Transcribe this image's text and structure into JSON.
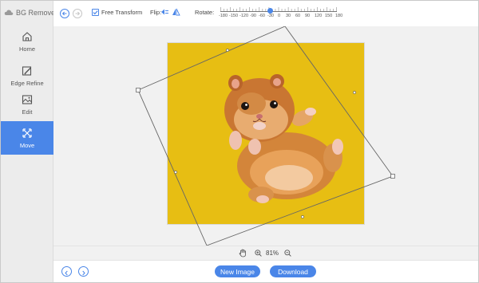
{
  "app": {
    "title": "BG Remover"
  },
  "sidebar": {
    "items": [
      {
        "label": "Home",
        "icon": "home-icon",
        "active": false
      },
      {
        "label": "Edge Refine",
        "icon": "edge-refine-icon",
        "active": false
      },
      {
        "label": "Edit",
        "icon": "image-edit-icon",
        "active": false
      },
      {
        "label": "Move",
        "icon": "move-icon",
        "active": true
      }
    ]
  },
  "toolbar": {
    "free_transform_label": "Free Transform",
    "free_transform_checked": true,
    "flip_label": "Flip:",
    "rotate_label": "Rotate:",
    "rotate_scale": [
      "-180",
      "-150",
      "-120",
      "-90",
      "-60",
      "-30",
      "0",
      "30",
      "60",
      "90",
      "120",
      "150",
      "180"
    ],
    "rotate_value": -30
  },
  "canvas": {
    "background_color": "#e7be13",
    "subject": "hamster"
  },
  "zoom": {
    "value": "81%"
  },
  "bottom": {
    "new_image_label": "New Image",
    "download_label": "Download"
  },
  "colors": {
    "accent": "#4a86e8",
    "sidebar_bg": "#ececec"
  }
}
